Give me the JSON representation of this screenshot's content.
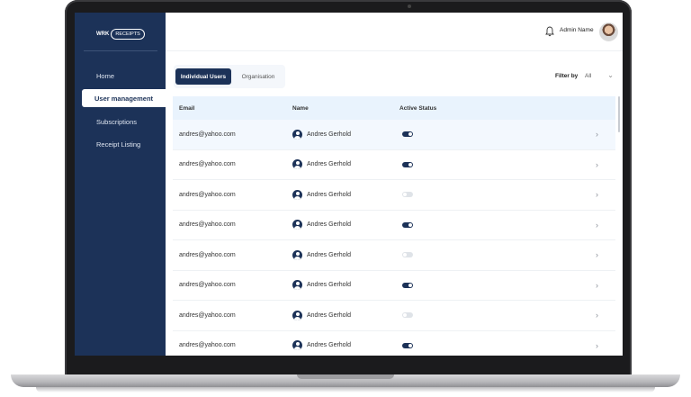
{
  "sidebar": {
    "logo": {
      "left": "WRK",
      "bubble": "RECEIPTS"
    },
    "items": [
      {
        "label": "Home"
      },
      {
        "label": "User management",
        "active": true
      },
      {
        "label": "Subscriptions"
      },
      {
        "label": "Receipt Listing"
      }
    ]
  },
  "header": {
    "admin_name": "Admin Name",
    "bell_icon": "bell-icon"
  },
  "tabs": [
    {
      "label": "Individual Users",
      "active": true
    },
    {
      "label": "Organisation",
      "active": false
    }
  ],
  "filter": {
    "label": "Filter by",
    "value": "All"
  },
  "table": {
    "columns": [
      "Email",
      "Name",
      "Active Status"
    ],
    "rows": [
      {
        "email": "andres@yahoo.com",
        "name": "Andres Gerhold",
        "active": true
      },
      {
        "email": "andres@yahoo.com",
        "name": "Andres Gerhold",
        "active": true
      },
      {
        "email": "andres@yahoo.com",
        "name": "Andres Gerhold",
        "active": false
      },
      {
        "email": "andres@yahoo.com",
        "name": "Andres Gerhold",
        "active": true
      },
      {
        "email": "andres@yahoo.com",
        "name": "Andres Gerhold",
        "active": false
      },
      {
        "email": "andres@yahoo.com",
        "name": "Andres Gerhold",
        "active": true
      },
      {
        "email": "andres@yahoo.com",
        "name": "Andres Gerhold",
        "active": false
      },
      {
        "email": "andres@yahoo.com",
        "name": "Andres Gerhold",
        "active": true
      }
    ]
  },
  "colors": {
    "primary": "#1c3258",
    "header_row": "#e9f3fd",
    "toggle_off": "#dfe3e8"
  }
}
